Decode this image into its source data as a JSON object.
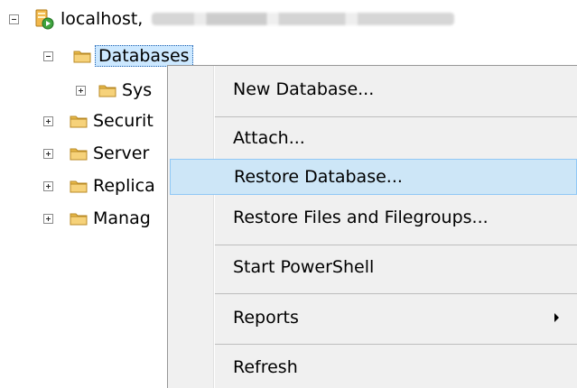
{
  "tree": {
    "server_label": "localhost,",
    "databases_label": "Databases",
    "items": [
      {
        "label": "Sys"
      },
      {
        "label": "Securit"
      },
      {
        "label": "Server"
      },
      {
        "label": "Replica"
      },
      {
        "label": "Manag"
      }
    ]
  },
  "context_menu": {
    "items": [
      {
        "label": "New Database..."
      },
      {
        "label": "Attach..."
      },
      {
        "label": "Restore Database...",
        "highlighted": true
      },
      {
        "label": "Restore Files and Filegroups..."
      },
      {
        "label": "Start PowerShell"
      },
      {
        "label": "Reports",
        "submenu": true
      },
      {
        "label": "Refresh"
      }
    ]
  },
  "colors": {
    "highlight": "#cde6f7",
    "selection": "#cce8ff",
    "menu_bg": "#f0f0f0"
  }
}
